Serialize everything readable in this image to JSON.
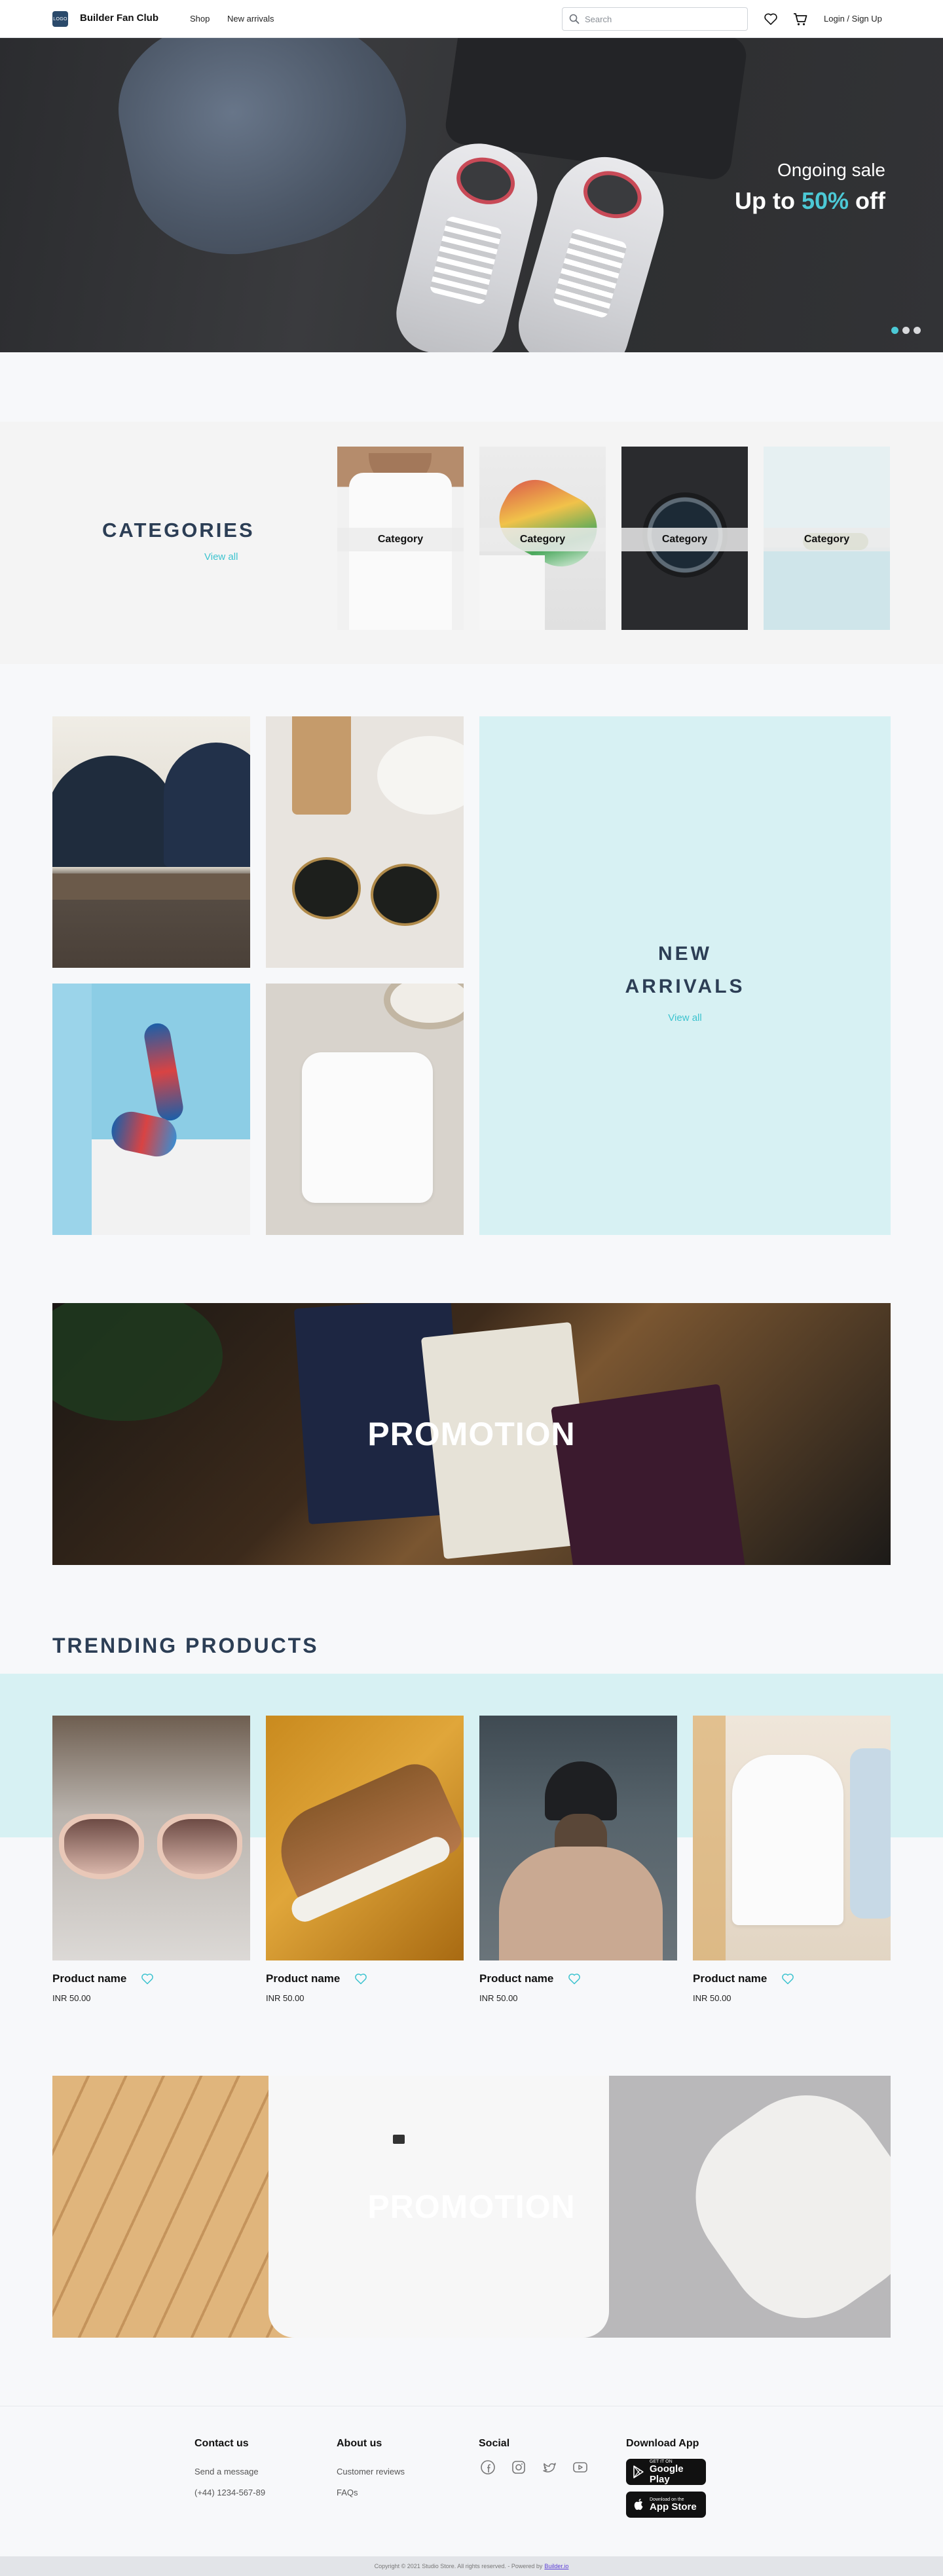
{
  "header": {
    "logo_text": "LOGO",
    "brand": "Builder Fan Club",
    "nav": [
      {
        "label": "Shop"
      },
      {
        "label": "New arrivals"
      }
    ],
    "search_placeholder": "Search",
    "login_label": "Login / Sign Up"
  },
  "hero": {
    "subtitle": "Ongoing sale",
    "title_prefix": "Up to ",
    "title_accent": "50%",
    "title_suffix": " off",
    "accent_color": "#4cc9d6",
    "slides": 3,
    "active_slide": 1
  },
  "categories": {
    "title": "CATEGORIES",
    "view_all": "View all",
    "items": [
      {
        "label": "Category"
      },
      {
        "label": "Category"
      },
      {
        "label": "Category"
      },
      {
        "label": "Category"
      }
    ]
  },
  "new_arrivals": {
    "title_line1": "NEW",
    "title_line2": "ARRIVALS",
    "view_all": "View all",
    "panel_color": "#d7f1f3"
  },
  "promotions": [
    {
      "label": "PROMOTION"
    },
    {
      "label": "PROMOTION"
    }
  ],
  "trending": {
    "title": "TRENDING PRODUCTS",
    "products": [
      {
        "name": "Product name",
        "price": "INR 50.00"
      },
      {
        "name": "Product name",
        "price": "INR 50.00"
      },
      {
        "name": "Product name",
        "price": "INR 50.00"
      },
      {
        "name": "Product name",
        "price": "INR 50.00"
      }
    ]
  },
  "footer": {
    "contact": {
      "title": "Contact us",
      "links": [
        "Send a message",
        "(+44) 1234-567-89"
      ]
    },
    "about": {
      "title": "About us",
      "links": [
        "Customer reviews",
        "FAQs"
      ]
    },
    "social": {
      "title": "Social",
      "icons": [
        "facebook-icon",
        "instagram-icon",
        "twitter-icon",
        "youtube-icon"
      ]
    },
    "download": {
      "title": "Download App",
      "google_small": "GET IT ON",
      "google_big": "Google Play",
      "apple_small": "Download on the",
      "apple_big": "App Store"
    },
    "copyright": "Copyright © 2021 Studio Store. All rights reserved. - Powered by",
    "powered_link": "Builder.io"
  }
}
